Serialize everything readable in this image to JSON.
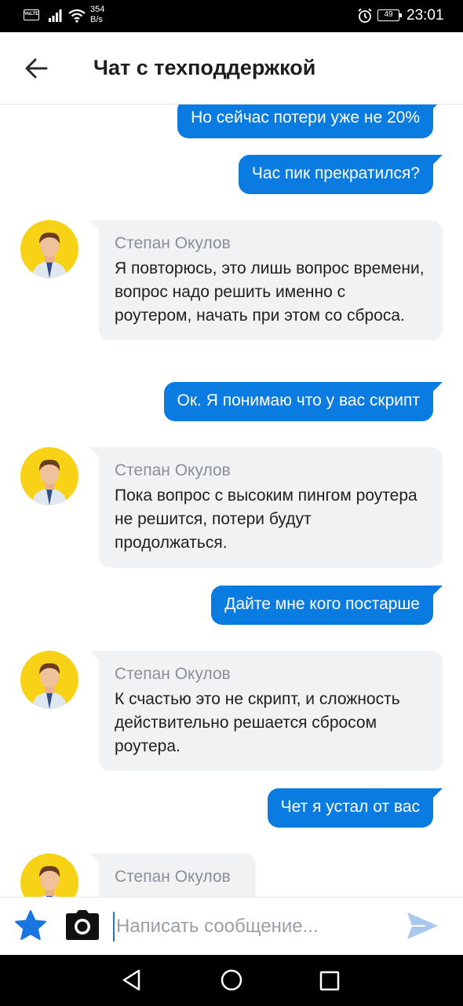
{
  "status_bar": {
    "volte": "VoLTE",
    "speed_value": "354",
    "speed_unit": "B/s",
    "battery": "49",
    "time": "23:01"
  },
  "app_bar": {
    "title": "Чат с техподдержкой",
    "back_icon": "arrow-left-icon"
  },
  "messages": [
    {
      "type": "out",
      "text": "Но сейчас потери уже не 20%"
    },
    {
      "type": "out",
      "text": "Час пик прекратился?"
    },
    {
      "type": "in",
      "sender": "Степан Окулов",
      "text": "Я повторюсь, это лишь вопрос времени, вопрос надо решить именно с роутером, начать при этом со сброса."
    },
    {
      "type": "out",
      "text": "Ок. Я понимаю что у вас скрипт"
    },
    {
      "type": "in",
      "sender": "Степан Окулов",
      "text": "Пока вопрос с высоким пингом роутера не решится, потери будут продолжаться."
    },
    {
      "type": "out",
      "text": "Дайте мне кого постарше"
    },
    {
      "type": "in",
      "sender": "Степан Окулов",
      "text": "К счастью это не скрипт, и сложность действительно решается сбросом роутера."
    },
    {
      "type": "out",
      "text": "Чет я устал от вас"
    },
    {
      "type": "in",
      "sender": "Степан Окулов",
      "text": ""
    }
  ],
  "input_bar": {
    "placeholder": "Написать сообщение...",
    "value": "",
    "icons": [
      "star-icon",
      "camera-icon",
      "send-icon"
    ]
  },
  "nav_bar": {
    "icons": [
      "nav-back-icon",
      "nav-home-icon",
      "nav-recent-icon"
    ]
  },
  "colors": {
    "accent": "#0a7be0",
    "incoming_bubble": "#f1f2f4",
    "avatar_bg": "#f7d216"
  }
}
